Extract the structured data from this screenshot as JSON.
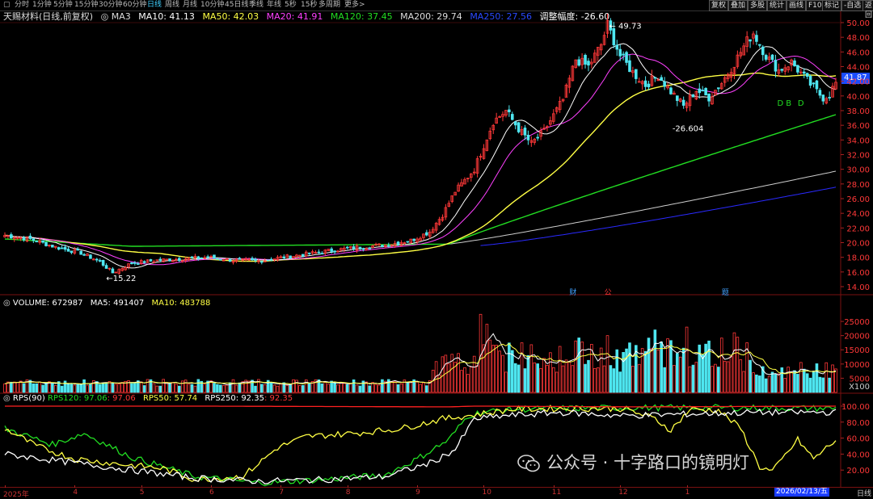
{
  "toolbar": {
    "periods": [
      "分时",
      "1分钟",
      "5分钟",
      "15分钟",
      "30分钟",
      "60分钟",
      "日线",
      "周线",
      "月线",
      "10分钟",
      "45日线",
      "季线",
      "年线",
      "5秒",
      "15秒",
      "多周期",
      "更多>"
    ],
    "active_period": "日线",
    "right_buttons": [
      "复权",
      "叠加",
      "多股",
      "统计",
      "画线",
      "F10",
      "标记",
      "-自选",
      "返回"
    ]
  },
  "main_legend": {
    "title": "天赐材料(日线,前复权)",
    "ma3_label": "MA3",
    "ma10": "MA10: 41.13",
    "ma50": "MA50: 42.03",
    "ma20": "MA20: 41.91",
    "ma120": "MA120: 37.45",
    "ma200": "MA200: 29.74",
    "ma250": "MA250: 27.56",
    "adjust": "调整幅度: -26.60"
  },
  "vol_legend": {
    "volume": "VOLUME: 672987",
    "ma5": "MA5: 491407",
    "ma10": "MA10: 483788"
  },
  "rps_legend": {
    "rps90": "RPS(90)",
    "rps120": "RPS120: 97.06",
    "rps120b": ": 97.06",
    "rps50": "RPS50: 57.74",
    "rps250": "RPS250: 92.35",
    "rps250b": ": 92.35"
  },
  "price_tag": "41.87",
  "annotations": {
    "high": "49.73",
    "low": "15.22",
    "drop": "-26.604",
    "d1": "D",
    "d2": "D",
    "b": "B"
  },
  "event_markers": [
    "财",
    "公",
    "题"
  ],
  "xaxis": {
    "labels": [
      "2025年",
      "4",
      "5",
      "6",
      "7",
      "8",
      "9",
      "10",
      "11",
      "12",
      "1"
    ],
    "current_date": "2026/02/13/五",
    "right_label": "日线"
  },
  "watermark": "公众号 · 十字路口的镜明灯",
  "colors": {
    "up": "#ff3838",
    "down": "#4ee6f0",
    "ma10": "#ffffff",
    "ma20": "#ff40ff",
    "ma50": "#ffff44",
    "ma120": "#22dd22",
    "ma200": "#cccccc",
    "ma250": "#2a2aff"
  },
  "chart_data": [
    {
      "type": "candlestick",
      "panel": "price",
      "y_ticks": [
        14.0,
        16.0,
        18.0,
        20.0,
        22.0,
        24.0,
        26.0,
        28.0,
        30.0,
        32.0,
        34.0,
        36.0,
        38.0,
        40.0,
        42.0,
        44.0,
        46.0,
        48.0,
        50.0
      ],
      "ylim": [
        14,
        50
      ],
      "anchors": [
        [
          0,
          21.0
        ],
        [
          8,
          20.5
        ],
        [
          16,
          19.4
        ],
        [
          24,
          18.6
        ],
        [
          30,
          17.4
        ],
        [
          34,
          15.9
        ],
        [
          40,
          17.2
        ],
        [
          48,
          17.6
        ],
        [
          56,
          17.8
        ],
        [
          64,
          18.0
        ],
        [
          72,
          17.6
        ],
        [
          80,
          17.5
        ],
        [
          86,
          17.9
        ],
        [
          96,
          18.5
        ],
        [
          104,
          19.0
        ],
        [
          112,
          19.4
        ],
        [
          120,
          19.7
        ],
        [
          128,
          20.3
        ],
        [
          134,
          21.5
        ],
        [
          138,
          23.8
        ],
        [
          142,
          27.0
        ],
        [
          148,
          30.0
        ],
        [
          154,
          36.5
        ],
        [
          158,
          38.0
        ],
        [
          162,
          35.5
        ],
        [
          166,
          33.5
        ],
        [
          170,
          35.2
        ],
        [
          176,
          39.5
        ],
        [
          180,
          45.0
        ],
        [
          184,
          44.0
        ],
        [
          188,
          47.0
        ],
        [
          190,
          49.7
        ],
        [
          194,
          45.5
        ],
        [
          198,
          43.2
        ],
        [
          202,
          41.5
        ],
        [
          206,
          42.8
        ],
        [
          210,
          40.6
        ],
        [
          214,
          38.6
        ],
        [
          218,
          40.8
        ],
        [
          222,
          39.8
        ],
        [
          226,
          41.8
        ],
        [
          230,
          44.5
        ],
        [
          234,
          47.5
        ],
        [
          236,
          48.6
        ],
        [
          240,
          45.5
        ],
        [
          244,
          43.5
        ],
        [
          248,
          44.6
        ],
        [
          252,
          42.6
        ],
        [
          256,
          40.6
        ],
        [
          258,
          39.8
        ],
        [
          260,
          40.2
        ],
        [
          262,
          41.87
        ]
      ],
      "ma_final": {
        "MA10": 41.13,
        "MA20": 41.91,
        "MA50": 42.03,
        "MA120": 37.45,
        "MA200": 29.74,
        "MA250": 27.56
      }
    },
    {
      "type": "bar",
      "panel": "volume",
      "unit": "X100",
      "y_ticks": [
        5000,
        10000,
        15000,
        20000,
        25000
      ],
      "ylim": [
        0,
        29000
      ]
    },
    {
      "type": "line",
      "panel": "rps",
      "y_ticks": [
        20.0,
        40.0,
        60.0,
        80.0,
        100.0
      ],
      "ylim": [
        0,
        105
      ],
      "series": [
        {
          "name": "RPS120",
          "anchors": [
            [
              0,
              72
            ],
            [
              15,
              52
            ],
            [
              25,
              66
            ],
            [
              40,
              36
            ],
            [
              60,
              12
            ],
            [
              80,
              4
            ],
            [
              100,
              8
            ],
            [
              120,
              14
            ],
            [
              130,
              34
            ],
            [
              140,
              58
            ],
            [
              146,
              88
            ],
            [
              150,
              92
            ],
            [
              160,
              96
            ],
            [
              175,
              97
            ],
            [
              200,
              98
            ],
            [
              230,
              98
            ],
            [
              262,
              97.06
            ]
          ]
        },
        {
          "name": "RPS50",
          "anchors": [
            [
              0,
              72
            ],
            [
              10,
              50
            ],
            [
              22,
              34
            ],
            [
              35,
              28
            ],
            [
              50,
              22
            ],
            [
              60,
              8
            ],
            [
              75,
              12
            ],
            [
              86,
              48
            ],
            [
              95,
              62
            ],
            [
              110,
              66
            ],
            [
              125,
              72
            ],
            [
              138,
              84
            ],
            [
              146,
              88
            ],
            [
              160,
              96
            ],
            [
              175,
              97
            ],
            [
              195,
              97
            ],
            [
              205,
              84
            ],
            [
              210,
              70
            ],
            [
              216,
              96
            ],
            [
              225,
              95
            ],
            [
              232,
              72
            ],
            [
              238,
              24
            ],
            [
              242,
              18
            ],
            [
              250,
              58
            ],
            [
              255,
              34
            ],
            [
              262,
              57.74
            ]
          ]
        },
        {
          "name": "RPS250",
          "anchors": [
            [
              0,
              40
            ],
            [
              20,
              30
            ],
            [
              40,
              20
            ],
            [
              60,
              10
            ],
            [
              80,
              6
            ],
            [
              100,
              8
            ],
            [
              120,
              12
            ],
            [
              135,
              30
            ],
            [
              142,
              46
            ],
            [
              148,
              84
            ],
            [
              158,
              88
            ],
            [
              175,
              92
            ],
            [
              195,
              88
            ],
            [
              215,
              90
            ],
            [
              235,
              92
            ],
            [
              262,
              92.35
            ]
          ]
        },
        {
          "name": "RPS90",
          "anchors": [
            [
              0,
              100
            ],
            [
              60,
              100
            ],
            [
              140,
              99
            ],
            [
              148,
              100
            ],
            [
              200,
              99
            ],
            [
              262,
              100
            ]
          ]
        }
      ]
    }
  ]
}
